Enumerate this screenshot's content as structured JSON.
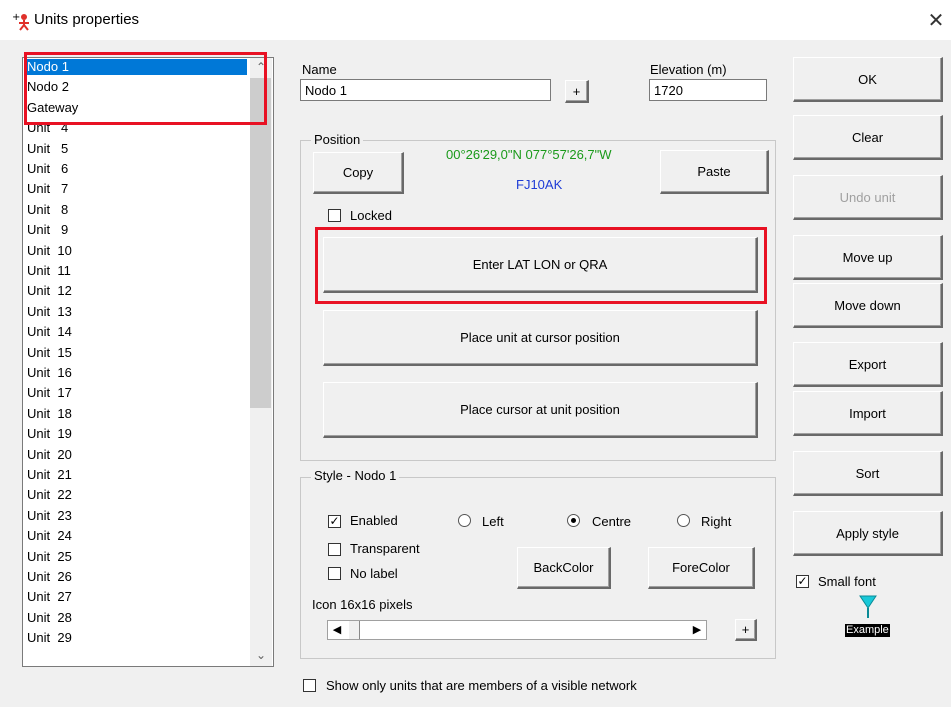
{
  "window": {
    "title": "Units properties",
    "close_glyph": "✕"
  },
  "unit_list": {
    "selected_index": 0,
    "items": [
      "Nodo 1",
      "Nodo 2",
      "Gateway",
      "Unit   4",
      "Unit   5",
      "Unit   6",
      "Unit   7",
      "Unit   8",
      "Unit   9",
      "Unit  10",
      "Unit  11",
      "Unit  12",
      "Unit  13",
      "Unit  14",
      "Unit  15",
      "Unit  16",
      "Unit  17",
      "Unit  18",
      "Unit  19",
      "Unit  20",
      "Unit  21",
      "Unit  22",
      "Unit  23",
      "Unit  24",
      "Unit  25",
      "Unit  26",
      "Unit  27",
      "Unit  28",
      "Unit  29"
    ]
  },
  "name_field": {
    "label": "Name",
    "value": "Nodo 1",
    "plus": "+"
  },
  "elevation_field": {
    "label": "Elevation (m)",
    "value": "1720"
  },
  "position": {
    "title": "Position",
    "copy": "Copy",
    "paste": "Paste",
    "coords": "00°26'29,0\"N 077°57'26,7\"W",
    "locator": "FJ10AK",
    "locked_label": "Locked",
    "enter_latlon": "Enter LAT LON or QRA",
    "place_unit": "Place unit at cursor position",
    "place_cursor": "Place cursor at unit position"
  },
  "style": {
    "title": "Style - Nodo 1",
    "enabled": "Enabled",
    "transparent": "Transparent",
    "no_label": "No label",
    "left": "Left",
    "centre": "Centre",
    "right": "Right",
    "backcolor": "BackColor",
    "forecolor": "ForeColor",
    "icon_size": "Icon 16x16 pixels",
    "plus": "+"
  },
  "buttons": {
    "ok": "OK",
    "clear": "Clear",
    "undo": "Undo unit",
    "move_up": "Move up",
    "move_down": "Move down",
    "export": "Export",
    "import": "Import",
    "sort": "Sort",
    "apply_style": "Apply style"
  },
  "small_font": {
    "label": "Small font",
    "example": "Example"
  },
  "show_only": "Show only units that are members of a visible network",
  "colors": {
    "coords": "#1a9a1a",
    "locator": "#1e3cd6",
    "highlight": "#e81123",
    "selection": "#0078d7",
    "marker": "#18c8d8"
  }
}
